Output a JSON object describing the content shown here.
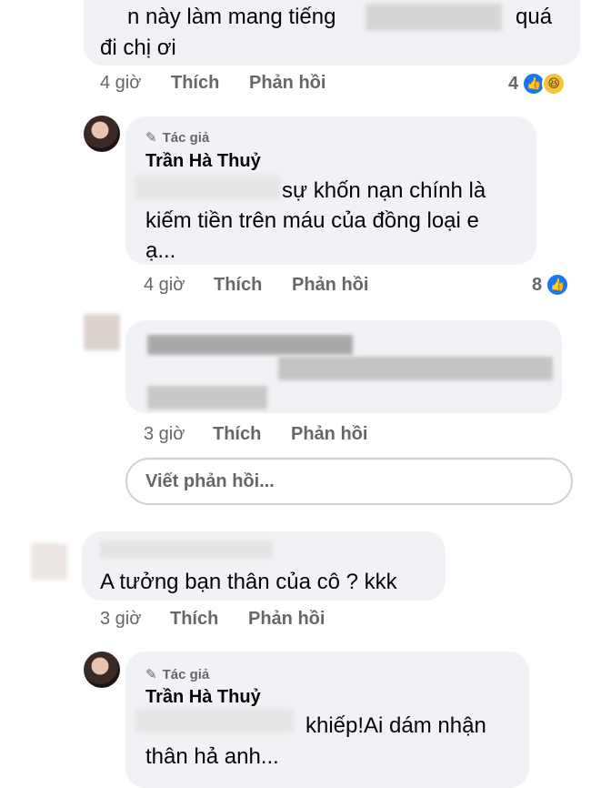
{
  "comments": [
    {
      "text_line1": "n này làm mang tiếng",
      "text_line1_end": "quá",
      "text_line2": "đi chị ơi",
      "time": "4 giờ",
      "like": "Thích",
      "reply": "Phản hồi",
      "reactions": "4"
    },
    {
      "badge": "Tác giả",
      "author": "Trần Hà Thuỷ",
      "text_line1": "sự khốn nạn chính là",
      "text_line2": "kiếm tiền trên máu của đồng loại e",
      "text_line3": "ạ...",
      "time": "4 giờ",
      "like": "Thích",
      "reply": "Phản hồi",
      "reactions": "8"
    },
    {
      "time": "3 giờ",
      "like": "Thích",
      "reply": "Phản hồi"
    },
    {
      "text": "A tưởng bạn thân của cô ? kkk",
      "time": "3 giờ",
      "like": "Thích",
      "reply": "Phản hồi"
    },
    {
      "badge": "Tác giả",
      "author": "Trần Hà Thuỷ",
      "text_line1": "khiếp!Ai dám nhận",
      "text_line2": "thân hả anh..."
    }
  ],
  "reply_box": {
    "placeholder": "Viết phản hồi..."
  },
  "colors": {
    "bubble": "#f0f2f5",
    "meta": "#65676b",
    "like_blue": "#1877f2",
    "haha_yellow": "#f7c33b"
  }
}
